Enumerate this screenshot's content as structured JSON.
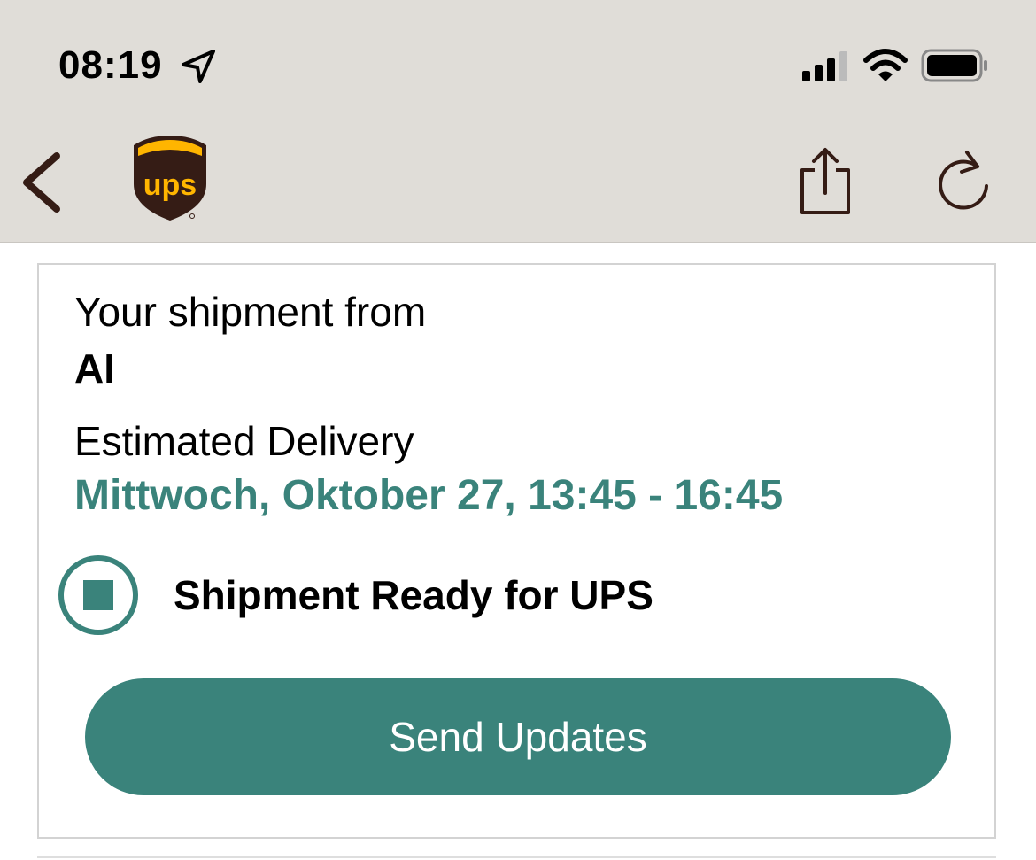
{
  "status_bar": {
    "time": "08:19",
    "location_icon": "location-arrow-icon",
    "signal_icon": "cellular-signal-icon",
    "wifi_icon": "wifi-icon",
    "battery_icon": "battery-icon"
  },
  "nav_bar": {
    "back_icon": "chevron-left-icon",
    "logo_text": "ups",
    "share_icon": "share-icon",
    "refresh_icon": "refresh-icon"
  },
  "shipment": {
    "from_label": "Your shipment from",
    "from_value": "AI",
    "eta_label": "Estimated Delivery",
    "eta_value": "Mittwoch, Oktober 27, 13:45 - 16:45",
    "status_icon": "status-indicator-icon",
    "status_text": "Shipment Ready for UPS"
  },
  "actions": {
    "send_updates_label": "Send Updates"
  },
  "colors": {
    "accent": "#3a837b",
    "nav_icon": "#351c15",
    "topbar_bg": "#e0ddd8",
    "ups_brown": "#351c15",
    "ups_gold": "#ffb500"
  }
}
